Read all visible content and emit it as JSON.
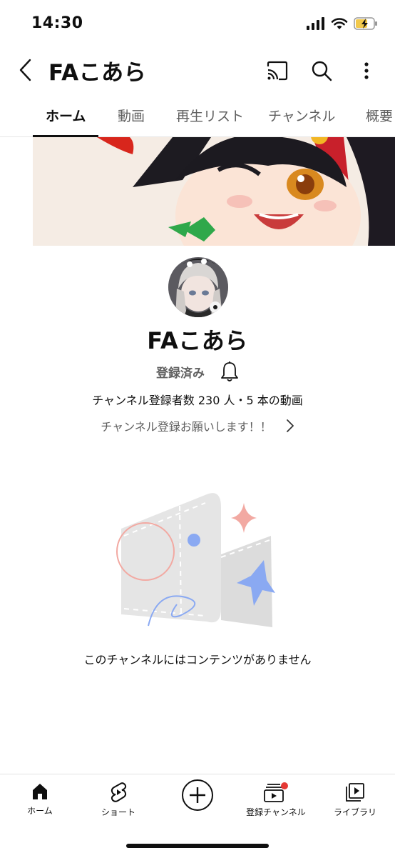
{
  "status_bar": {
    "time": "14:30"
  },
  "header": {
    "title": "FAこあら"
  },
  "tabs": [
    {
      "label": "ホーム",
      "active": true
    },
    {
      "label": "動画",
      "active": false
    },
    {
      "label": "再生リスト",
      "active": false
    },
    {
      "label": "チャンネル",
      "active": false
    },
    {
      "label": "概要",
      "active": false
    }
  ],
  "channel": {
    "name": "FAこあら",
    "subscribed_label": "登録済み",
    "stats": "チャンネル登録者数 230 人・5 本の動画",
    "description": "チャンネル登録お願いします！！"
  },
  "empty_state": {
    "message": "このチャンネルにはコンテンツがありません"
  },
  "bottom_nav": [
    {
      "label": "ホーム",
      "icon": "home-icon"
    },
    {
      "label": "ショート",
      "icon": "shorts-icon"
    },
    {
      "label": "",
      "icon": "create-icon"
    },
    {
      "label": "登録チャンネル",
      "icon": "subscriptions-icon"
    },
    {
      "label": "ライブラリ",
      "icon": "library-icon"
    }
  ],
  "colors": {
    "accent_red": "#e53935",
    "text_secondary": "#606060"
  }
}
